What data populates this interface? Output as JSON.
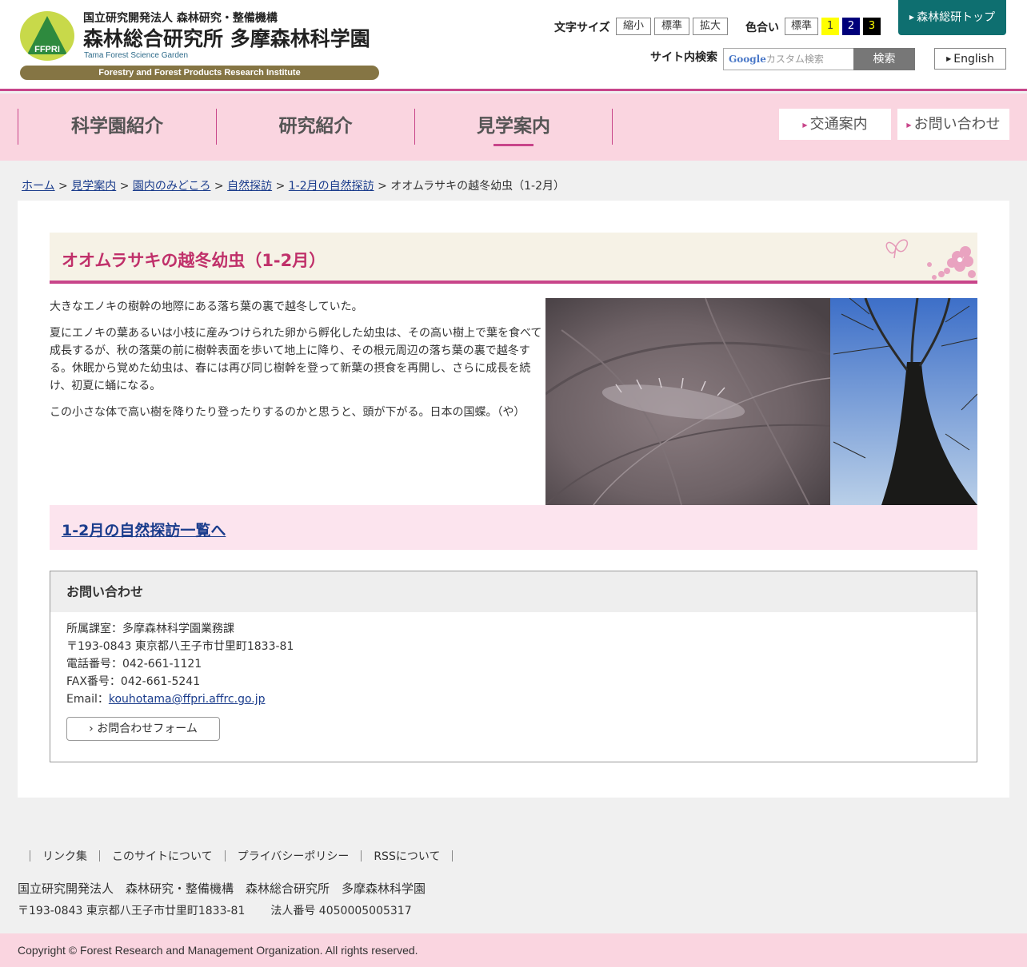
{
  "header": {
    "org_line1": "国立研究開発法人 森林研究・整備機構",
    "org_line2": "森林総合研究所 多摩森林科学園",
    "org_line3": "Tama Forest Science Garden",
    "org_band": "Forestry and Forest Products Research Institute",
    "logo_text": "FFPRI",
    "font_size_label": "文字サイズ",
    "font_size_options": [
      "縮小",
      "標準",
      "拡大"
    ],
    "color_label": "色合い",
    "color_options": [
      "標準",
      "1",
      "2",
      "3"
    ],
    "top_link": "森林総研トップ",
    "search_label": "サイト内検索",
    "search_google": "Google",
    "search_placeholder": "カスタム検索",
    "search_button": "検索",
    "english_button": "English"
  },
  "nav": {
    "items": [
      "科学園紹介",
      "研究紹介",
      "見学案内"
    ],
    "buttons": [
      "交通案内",
      "お問い合わせ"
    ]
  },
  "breadcrumb": {
    "links": [
      "ホーム",
      "見学案内",
      "園内のみどころ",
      "自然探訪",
      "1-2月の自然探訪"
    ],
    "current": "オオムラサキの越冬幼虫（1-2月）",
    "separator": ">"
  },
  "article": {
    "title": "オオムラサキの越冬幼虫（1-2月）",
    "paragraphs": [
      "大きなエノキの樹幹の地際にある落ち葉の裏で越冬していた。",
      "夏にエノキの葉あるいは小枝に産みつけられた卵から孵化した幼虫は、その高い樹上で葉を食べて成長するが、秋の落葉の前に樹幹表面を歩いて地上に降り、その根元周辺の落ち葉の裏で越冬する。休眠から覚めた幼虫は、春には再び同じ樹幹を登って新葉の摂食を再開し、さらに成長を続け、初夏に蛹になる。",
      "この小さな体で高い樹を降りたり登ったりするのかと思うと、頭が下がる。日本の国蝶。（や）"
    ],
    "list_link": "1-2月の自然探訪一覧へ"
  },
  "contact": {
    "heading": "お問い合わせ",
    "dept": "所属課室：多摩森林科学園業務課",
    "address": "〒193-0843 東京都八王子市廿里町1833-81",
    "tel": "電話番号：042-661-1121",
    "fax": "FAX番号：042-661-5241",
    "email_label": "Email：",
    "email": "kouhotama@ffpri.affrc.go.jp",
    "form_button": "お問合わせフォーム"
  },
  "footer": {
    "links": [
      "リンク集",
      "このサイトについて",
      "プライバシーポリシー",
      "RSSについて"
    ],
    "org": "国立研究開発法人　森林研究・整備機構　森林総合研究所　多摩森林科学園",
    "address": "〒193-0843 東京都八王子市廿里町1833-81",
    "corp_number": "法人番号 4050005005317",
    "copyright": "Copyright © Forest Research and Management Organization. All rights reserved."
  },
  "colors": {
    "accent_pink": "#c8458a",
    "nav_bg": "#fad5e0",
    "title_color": "#c0306a",
    "top_link_bg": "#0e6f70"
  }
}
